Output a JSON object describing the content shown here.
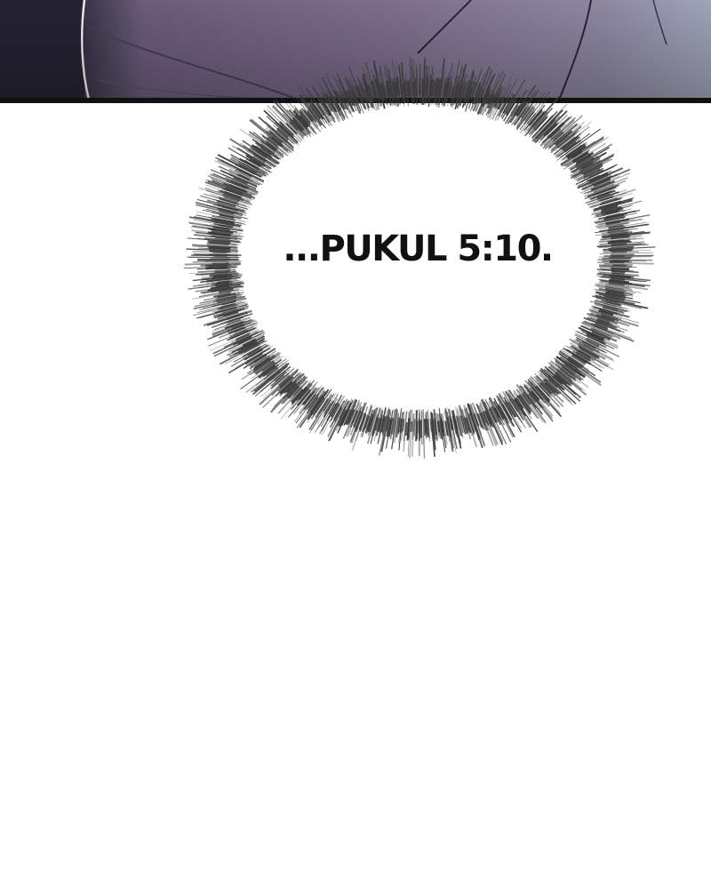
{
  "panel_text": {
    "caption": "...PUKUL 5:10."
  },
  "colors": {
    "panel_dark": "#2a2838",
    "panel_mid": "#6e6280",
    "panel_light": "#9a9cb0",
    "border": "#111111",
    "burst": "#3a3a3a",
    "background": "#ffffff"
  }
}
